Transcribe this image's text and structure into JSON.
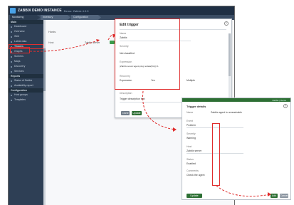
{
  "app": {
    "title": "ZABBIX DEMO INSTANCE",
    "subtitle": "Demo: Zabbix 4.0.0",
    "tabs": [
      "Monitoring",
      "Inventory",
      "Configuration"
    ]
  },
  "sidebar": {
    "sections": [
      {
        "label": "Main",
        "items": [
          "Dashboard",
          "Overview",
          "Web",
          "Latest data",
          "Triggers",
          "Graphs",
          "Screens",
          "Maps",
          "Discovery",
          "Services"
        ]
      },
      {
        "label": "Reports",
        "items": [
          "Status of Zabbix",
          "Availability report"
        ]
      },
      {
        "label": "Configuration",
        "items": [
          "Host groups",
          "Templates"
        ]
      }
    ],
    "highlighted_item": "Triggers"
  },
  "main": {
    "heading": "Hosts",
    "row_label": "Host:",
    "row_value": "Zabbix server"
  },
  "dialog1": {
    "title": "Edit trigger",
    "close": "?",
    "fields": [
      {
        "label": "Name",
        "value": "Zabbix"
      },
      {
        "label": "Severity",
        "value": "Not classified"
      },
      {
        "label": "Expression",
        "value": "{Zabbix server:agent.ping.nodata(5m)}=1"
      },
      {
        "label": "Recovery",
        "value": "Expression"
      },
      {
        "label": "OK event",
        "value": "Yes"
      },
      {
        "label": "PROBLEM",
        "value": "Multiple"
      },
      {
        "label": "URL",
        "value": ""
      },
      {
        "label": "Description",
        "value": "Trigger description text"
      }
    ],
    "buttons": {
      "update": "Update",
      "clone": "Clone"
    }
  },
  "dialog2": {
    "header": "Zabbix | Demo",
    "title": "Trigger details",
    "close": "?",
    "fields": [
      {
        "label": "Name",
        "value": "Zabbix agent is unreachable"
      },
      {
        "label": "Event",
        "value": "Problem"
      },
      {
        "label": "Severity",
        "value": "Warning"
      },
      {
        "label": "Host",
        "value": "Zabbix server"
      },
      {
        "label": "Status",
        "value": "Enabled"
      },
      {
        "label": "Dependencies",
        "value": "None"
      },
      {
        "label": "Comments",
        "value": "Check the agent"
      }
    ],
    "buttons": {
      "update": "Update",
      "cancel": "Cancel",
      "add": "Add"
    }
  },
  "colors": {
    "header": "#1f2f44",
    "sidebar": "#2e3f55",
    "accent_green": "#2d6f34",
    "callout_red": "#e02c2c"
  }
}
